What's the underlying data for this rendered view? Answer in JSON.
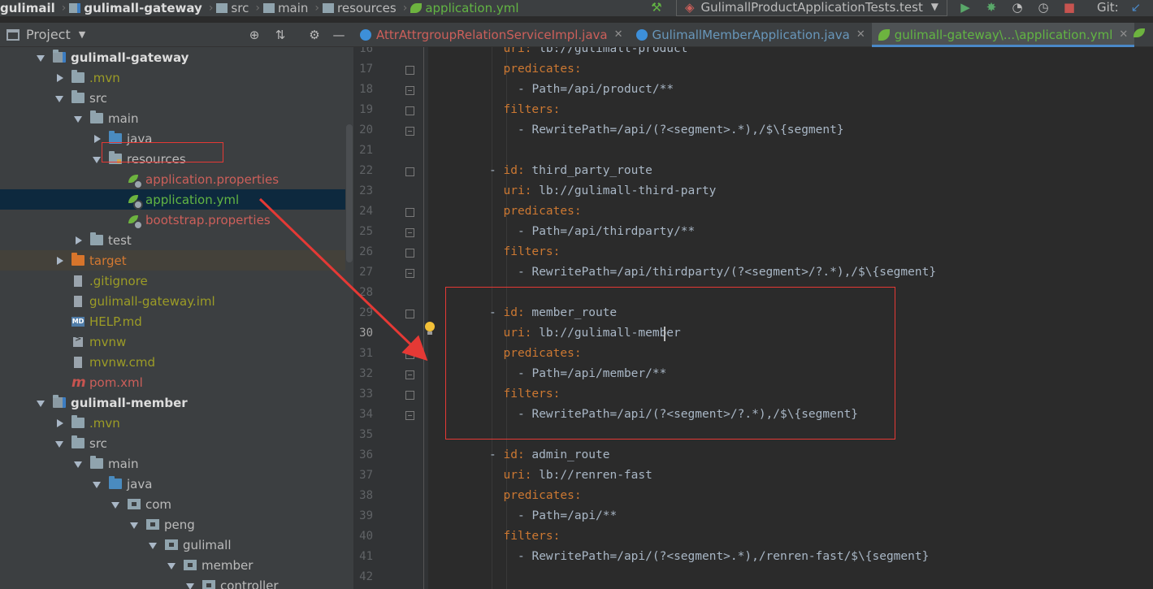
{
  "breadcrumb": {
    "items": [
      "gulimail",
      "gulimall-gateway",
      "src",
      "main",
      "resources",
      "application.yml"
    ]
  },
  "run_config": {
    "label": "GulimallProductApplicationTests.test"
  },
  "toolbar": {
    "git_label": "Git:",
    "icons": [
      "hammer-icon",
      "run-icon",
      "debug-icon",
      "coverage-icon",
      "profile-icon",
      "stop-icon",
      "vcs-update-icon"
    ]
  },
  "project_panel": {
    "title": "Project",
    "tree": [
      {
        "label": "gulimall-gateway",
        "level": 0,
        "arrow": "down",
        "icon": "module",
        "style": "module"
      },
      {
        "label": ".mvn",
        "level": 1,
        "arrow": "right",
        "icon": "folder",
        "style": "olive"
      },
      {
        "label": "src",
        "level": 1,
        "arrow": "down",
        "icon": "folder",
        "style": "normal"
      },
      {
        "label": "main",
        "level": 2,
        "arrow": "down",
        "icon": "folder",
        "style": "normal"
      },
      {
        "label": "java",
        "level": 3,
        "arrow": "right",
        "icon": "folder-blue",
        "style": "normal"
      },
      {
        "label": "resources",
        "level": 3,
        "arrow": "down",
        "icon": "folder-res",
        "style": "normal"
      },
      {
        "label": "application.properties",
        "level": 4,
        "arrow": "none",
        "icon": "spring",
        "style": "red"
      },
      {
        "label": "application.yml",
        "level": 4,
        "arrow": "none",
        "icon": "spring",
        "style": "green",
        "selected": true
      },
      {
        "label": "bootstrap.properties",
        "level": 4,
        "arrow": "none",
        "icon": "spring",
        "style": "red"
      },
      {
        "label": "test",
        "level": 2,
        "arrow": "right",
        "icon": "folder",
        "style": "normal"
      },
      {
        "label": "target",
        "level": 1,
        "arrow": "right",
        "icon": "folder-orange",
        "style": "orange",
        "dim": true
      },
      {
        "label": ".gitignore",
        "level": 1,
        "arrow": "none",
        "icon": "file",
        "style": "olive"
      },
      {
        "label": "gulimall-gateway.iml",
        "level": 1,
        "arrow": "none",
        "icon": "file",
        "style": "olive"
      },
      {
        "label": "HELP.md",
        "level": 1,
        "arrow": "none",
        "icon": "md",
        "style": "olive"
      },
      {
        "label": "mvnw",
        "level": 1,
        "arrow": "none",
        "icon": "term",
        "style": "olive"
      },
      {
        "label": "mvnw.cmd",
        "level": 1,
        "arrow": "none",
        "icon": "file",
        "style": "olive"
      },
      {
        "label": "pom.xml",
        "level": 1,
        "arrow": "none",
        "icon": "maven",
        "style": "red"
      },
      {
        "label": "gulimall-member",
        "level": 0,
        "arrow": "down",
        "icon": "module",
        "style": "module"
      },
      {
        "label": ".mvn",
        "level": 1,
        "arrow": "right",
        "icon": "folder",
        "style": "olive"
      },
      {
        "label": "src",
        "level": 1,
        "arrow": "down",
        "icon": "folder",
        "style": "normal"
      },
      {
        "label": "main",
        "level": 2,
        "arrow": "down",
        "icon": "folder",
        "style": "normal"
      },
      {
        "label": "java",
        "level": 3,
        "arrow": "down",
        "icon": "folder-blue",
        "style": "normal"
      },
      {
        "label": "com",
        "level": 4,
        "arrow": "down",
        "icon": "pkg",
        "style": "normal"
      },
      {
        "label": "peng",
        "level": 5,
        "arrow": "down",
        "icon": "pkg",
        "style": "normal"
      },
      {
        "label": "gulimall",
        "level": 6,
        "arrow": "down",
        "icon": "pkg",
        "style": "normal"
      },
      {
        "label": "member",
        "level": 7,
        "arrow": "down",
        "icon": "pkg",
        "style": "normal"
      },
      {
        "label": "controller",
        "level": 8,
        "arrow": "down",
        "icon": "pkg",
        "style": "normal"
      }
    ]
  },
  "editor_tabs": [
    {
      "label": "AttrAttrgroupRelationServiceImpl.java",
      "color": "#cc5f5a",
      "icon_color": "#3d8fd9",
      "active": false
    },
    {
      "label": "GulimallMemberApplication.java",
      "color": "#6897bb",
      "icon_color": "#3d8fd9",
      "active": false
    },
    {
      "label": "gulimall-gateway\\...\\application.yml",
      "color": "#62b543",
      "icon_color": "#6db33f",
      "active": true
    }
  ],
  "editor": {
    "current_line": 30,
    "lines": [
      {
        "n": 16,
        "indent": 6,
        "key": "uri",
        "value": " lb://gulimall-product"
      },
      {
        "n": 17,
        "indent": 6,
        "key": "predicates",
        "value": ""
      },
      {
        "n": 18,
        "indent": 8,
        "dash": true,
        "value": "Path=/api/product/**"
      },
      {
        "n": 19,
        "indent": 6,
        "key": "filters",
        "value": ""
      },
      {
        "n": 20,
        "indent": 8,
        "dash": true,
        "value": "RewritePath=/api/(?<segment>.*),/$\\{segment}"
      },
      {
        "n": 21,
        "indent": 0,
        "value": ""
      },
      {
        "n": 22,
        "indent": 4,
        "dash": true,
        "key": "id",
        "value": " third_party_route"
      },
      {
        "n": 23,
        "indent": 6,
        "key": "uri",
        "value": " lb://gulimall-third-party"
      },
      {
        "n": 24,
        "indent": 6,
        "key": "predicates",
        "value": ""
      },
      {
        "n": 25,
        "indent": 8,
        "dash": true,
        "value": "Path=/api/thirdparty/**"
      },
      {
        "n": 26,
        "indent": 6,
        "key": "filters",
        "value": ""
      },
      {
        "n": 27,
        "indent": 8,
        "dash": true,
        "value": "RewritePath=/api/thirdparty/(?<segment>/?.*),/$\\{segment}"
      },
      {
        "n": 28,
        "indent": 0,
        "value": ""
      },
      {
        "n": 29,
        "indent": 4,
        "dash": true,
        "key": "id",
        "value": " member_route"
      },
      {
        "n": 30,
        "indent": 6,
        "key": "uri",
        "value": " lb://gulimall-member"
      },
      {
        "n": 31,
        "indent": 6,
        "key": "predicates",
        "value": ""
      },
      {
        "n": 32,
        "indent": 8,
        "dash": true,
        "value": "Path=/api/member/**"
      },
      {
        "n": 33,
        "indent": 6,
        "key": "filters",
        "value": ""
      },
      {
        "n": 34,
        "indent": 8,
        "dash": true,
        "value": "RewritePath=/api/(?<segment>/?.*),/$\\{segment}"
      },
      {
        "n": 35,
        "indent": 0,
        "value": ""
      },
      {
        "n": 36,
        "indent": 4,
        "dash": true,
        "key": "id",
        "value": " admin_route"
      },
      {
        "n": 37,
        "indent": 6,
        "key": "uri",
        "value": " lb://renren-fast"
      },
      {
        "n": 38,
        "indent": 6,
        "key": "predicates",
        "value": ""
      },
      {
        "n": 39,
        "indent": 8,
        "dash": true,
        "value": "Path=/api/**"
      },
      {
        "n": 40,
        "indent": 6,
        "key": "filters",
        "value": ""
      },
      {
        "n": 41,
        "indent": 8,
        "dash": true,
        "value": "RewritePath=/api/(?<segment>.*),/renren-fast/$\\{segment}"
      },
      {
        "n": 42,
        "indent": 0,
        "value": ""
      }
    ]
  },
  "colors": {
    "annotation_red": "#e53935",
    "yaml_key": "#cc7832",
    "yaml_value": "#a9b7c6",
    "selection_bg": "#0d293e"
  }
}
